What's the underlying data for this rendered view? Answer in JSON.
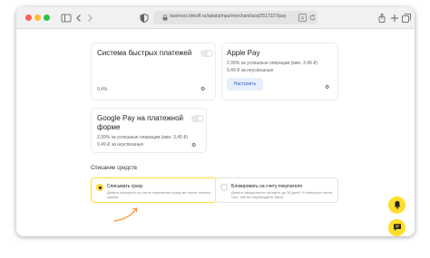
{
  "browser": {
    "url": "business.tinkoff.ru/oplata/mpa/merchant/acq/2517327/pay",
    "icons": {
      "sidebar": "sidebar-icon",
      "back": "chevron-left-icon",
      "forward": "chevron-right-icon",
      "shield": "shield-icon",
      "lock": "lock-icon",
      "translate": "translate-icon",
      "reload": "reload-icon",
      "share": "share-icon",
      "new_tab": "plus-icon",
      "tabs": "tabs-icon"
    },
    "colors": {
      "red": "#ff5f57",
      "yellow": "#febc2e",
      "green": "#28c840"
    }
  },
  "cards": {
    "sbp": {
      "title": "Система быстрых платежей",
      "rate": "0,4%"
    },
    "apple_pay": {
      "title": "Apple Pay",
      "success": "2,99% за успешные операции (мин. 3,49 ₽)",
      "failed": "0,49 ₽ за неуспешные",
      "button": "Настроить"
    },
    "google_pay": {
      "title_line1": "Google Pay на платежной",
      "title_line2": "форме",
      "success": "2,99% за успешные операции (мин. 3,49 ₽)",
      "failed": "0,49 ₽ за неуспешные"
    }
  },
  "debit": {
    "section_title": "Списание средств",
    "options": [
      {
        "title": "Списывать сразу",
        "desc": "Деньги спишутся со счета покупателя сразу же после оплаты заказа",
        "selected": true
      },
      {
        "title": "Блокировать на счету покупателя",
        "desc": "Деньги заморозятся на карте до 30 дней. И спишутся после того, как вы подтвердите заказ",
        "selected": false
      }
    ]
  },
  "accent": "#ffdd2d",
  "fab": {
    "notifications_icon": "bell-icon",
    "chat_icon": "chat-icon"
  }
}
